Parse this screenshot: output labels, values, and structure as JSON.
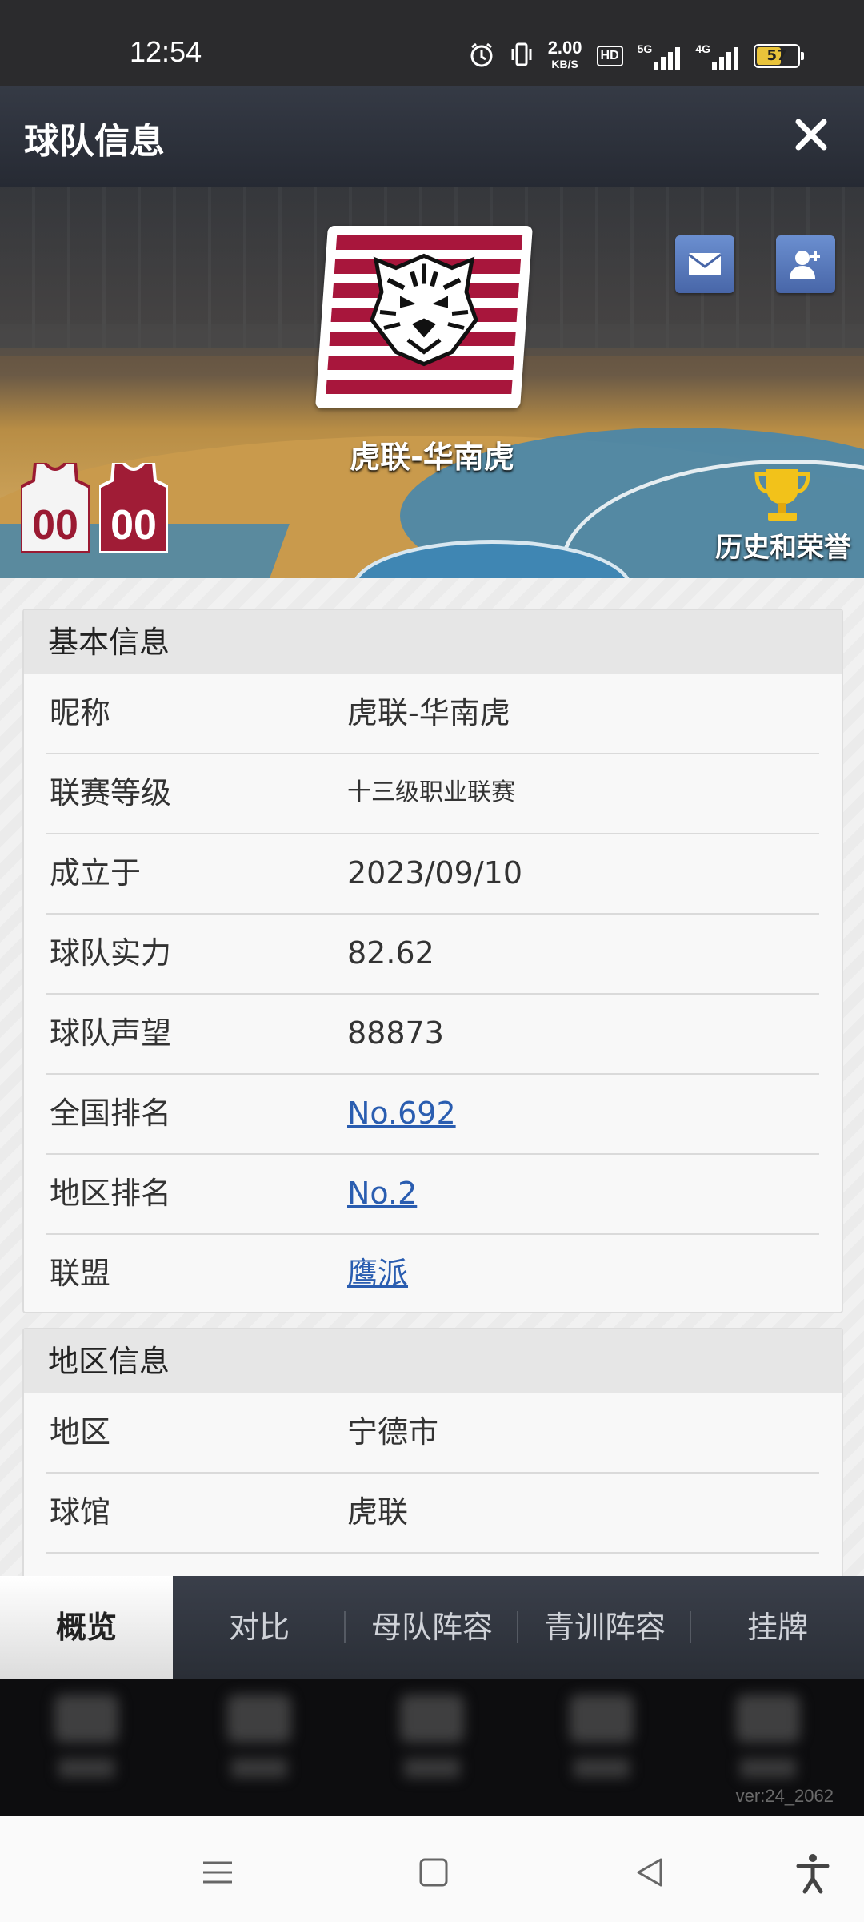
{
  "status_bar": {
    "time": "12:54",
    "net_speed": "2.00",
    "net_unit": "KB/S",
    "hd_label": "HD",
    "net1": "5G",
    "net2": "4G",
    "battery": "57"
  },
  "header": {
    "title": "球队信息",
    "close_icon": "close-icon"
  },
  "hero": {
    "team_name": "虎联-华南虎",
    "jersey_home_number": "00",
    "jersey_away_number": "00",
    "honors_label": "历史和荣誉",
    "colors": {
      "logo_red": "#a8163c",
      "button_blue": "#5577bb"
    }
  },
  "basic_info": {
    "title": "基本信息",
    "rows": [
      {
        "label": "昵称",
        "value": "虎联-华南虎"
      },
      {
        "label": "联赛等级",
        "value": "十三级职业联赛"
      },
      {
        "label": "成立于",
        "value": "2023/09/10"
      },
      {
        "label": "球队实力",
        "value": "82.62"
      },
      {
        "label": "球队声望",
        "value": "88873"
      },
      {
        "label": "全国排名",
        "value": "No.692"
      },
      {
        "label": "地区排名",
        "value": "No.2"
      },
      {
        "label": "联盟",
        "value": "鹰派"
      }
    ]
  },
  "region_info": {
    "title": "地区信息",
    "rows": [
      {
        "label": "地区",
        "value": "宁德市"
      },
      {
        "label": "球馆",
        "value": "虎联"
      }
    ]
  },
  "tabs": [
    {
      "label": "概览",
      "active": true
    },
    {
      "label": "对比"
    },
    {
      "label": "母队阵容"
    },
    {
      "label": "青训阵容"
    },
    {
      "label": "挂牌"
    }
  ],
  "footer": {
    "version": "ver:24_2062"
  }
}
